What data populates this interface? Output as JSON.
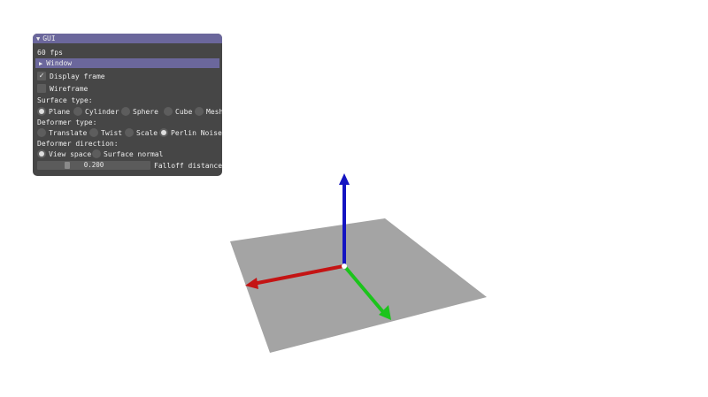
{
  "gui": {
    "title": "GUI",
    "fps": "60 fps",
    "window_header": "Window",
    "display_frame": {
      "label": "Display frame",
      "checked": true
    },
    "wireframe": {
      "label": "Wireframe",
      "checked": false
    },
    "surface_type": {
      "label": "Surface type:",
      "options": [
        "Plane",
        "Cylinder",
        "Sphere",
        "Cube",
        "Mesh"
      ],
      "selected": "Plane"
    },
    "deformer_type": {
      "label": "Deformer type:",
      "options": [
        "Translate",
        "Twist",
        "Scale",
        "Perlin Noise"
      ],
      "selected": "Perlin Noise"
    },
    "deformer_direction": {
      "label": "Deformer direction:",
      "options": [
        "View space",
        "Surface normal"
      ],
      "selected": "View space"
    },
    "falloff": {
      "label": "Falloff distance",
      "value": "0.200",
      "fraction": 0.2
    }
  },
  "scene": {
    "plane_color": "#a4a4a4",
    "axis_x_color": "#c41414",
    "axis_y_color": "#1414c2",
    "axis_z_color": "#1bc41b"
  }
}
